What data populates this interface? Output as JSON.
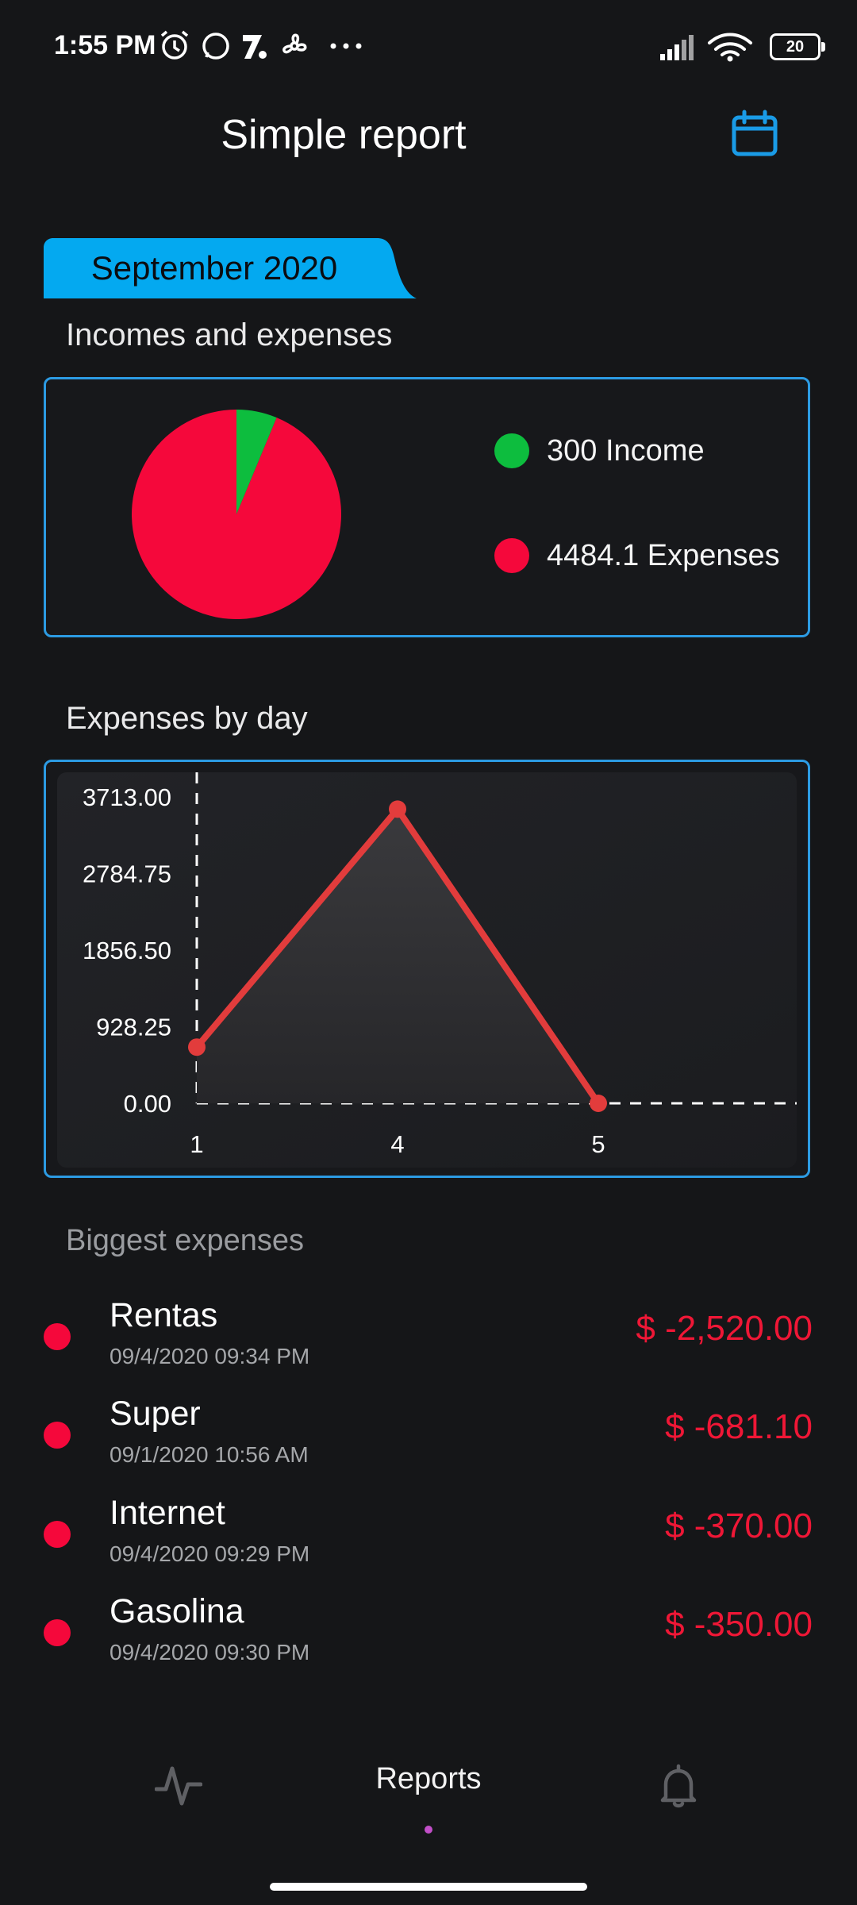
{
  "status_bar": {
    "time": "1:55 PM",
    "battery": "20",
    "icons": [
      "alarm-icon",
      "whatsapp-icon",
      "app-icon",
      "fan-icon",
      "more-dots-icon",
      "signal-icon",
      "wifi-icon",
      "battery-icon"
    ]
  },
  "header": {
    "title": "Simple report",
    "calendar_icon": "calendar-icon",
    "accent": "#1a9be6"
  },
  "month": {
    "label": "September 2020"
  },
  "incomes_section": {
    "title": "Incomes and expenses",
    "legend": [
      {
        "label": "300 Income",
        "color": "#0dbd3e"
      },
      {
        "label": "4484.1 Expenses",
        "color": "#f5083b"
      }
    ]
  },
  "chart_data": [
    {
      "type": "pie",
      "title": "Incomes and expenses",
      "categories": [
        "Income",
        "Expenses"
      ],
      "values": [
        300,
        4484.1
      ],
      "colors": [
        "#0dbd3e",
        "#f5083b"
      ],
      "legend": "right"
    },
    {
      "type": "area",
      "title": "Expenses by day",
      "x": [
        "1",
        "4",
        "5"
      ],
      "values": [
        681.1,
        3565,
        0
      ],
      "ylim": [
        0,
        3713
      ],
      "yticks": [
        "3713.00",
        "2784.75",
        "1856.50",
        "928.25",
        "0.00"
      ],
      "line_color": "#e23c3c"
    }
  ],
  "daily_section": {
    "title": "Expenses by day"
  },
  "biggest_section": {
    "title": "Biggest expenses",
    "items": [
      {
        "name": "Rentas",
        "date": "09/4/2020 09:34 PM",
        "amount": "$ -2,520.00"
      },
      {
        "name": "Super",
        "date": "09/1/2020 10:56 AM",
        "amount": "$ -681.10"
      },
      {
        "name": "Internet",
        "date": "09/4/2020 09:29 PM",
        "amount": "$ -370.00"
      },
      {
        "name": "Gasolina",
        "date": "09/4/2020 09:30 PM",
        "amount": "$ -350.00"
      }
    ]
  },
  "bottom_nav": {
    "items": [
      {
        "icon": "activity-icon"
      },
      {
        "label": "Reports"
      },
      {
        "icon": "bell-icon"
      }
    ]
  }
}
